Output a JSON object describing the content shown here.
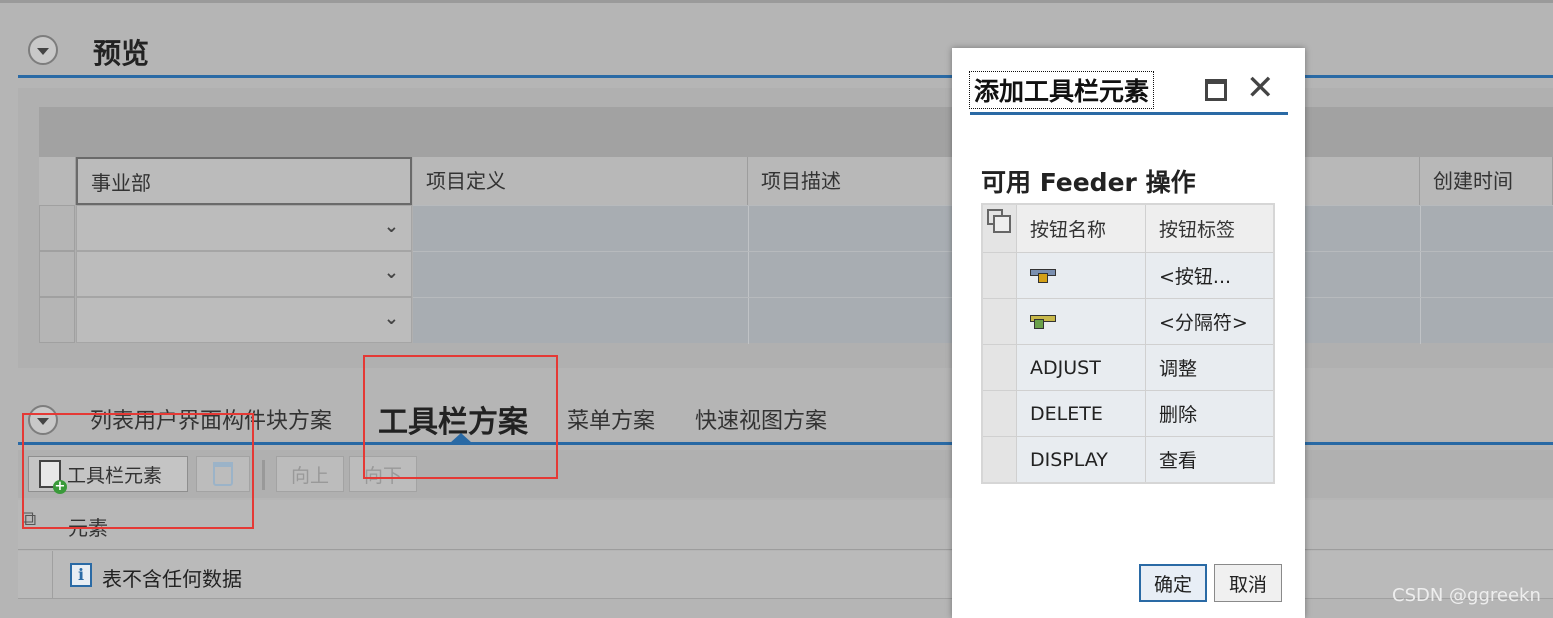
{
  "preview": {
    "title": "预览",
    "columns": [
      "事业部",
      "项目定义",
      "项目描述",
      "创建时间"
    ],
    "rows": 3
  },
  "tabs": {
    "items": [
      "列表用户界面构件块方案",
      "工具栏方案",
      "菜单方案",
      "快速视图方案"
    ],
    "active_index": 1
  },
  "toolbar": {
    "add_element_label": "工具栏元素",
    "up_label": "向上",
    "down_label": "向下"
  },
  "element_list": {
    "header": "元素",
    "empty_text": "表不含任何数据"
  },
  "dialog": {
    "title": "添加工具栏元素",
    "subtitle": "可用 Feeder 操作",
    "columns": [
      "按钮名称",
      "按钮标签"
    ],
    "rows": [
      {
        "name": "",
        "label": "<按钮...",
        "icon": "button-icon"
      },
      {
        "name": "",
        "label": "<分隔符>",
        "icon": "separator-icon"
      },
      {
        "name": "ADJUST",
        "label": "调整"
      },
      {
        "name": "DELETE",
        "label": "删除"
      },
      {
        "name": "DISPLAY",
        "label": "查看"
      }
    ],
    "ok_label": "确定",
    "cancel_label": "取消"
  },
  "watermark": "CSDN @ggreekn",
  "colors": {
    "accent_blue": "#2a6aa5",
    "highlight_red": "#e53935",
    "overlay_gray": "#b5b5b5"
  }
}
